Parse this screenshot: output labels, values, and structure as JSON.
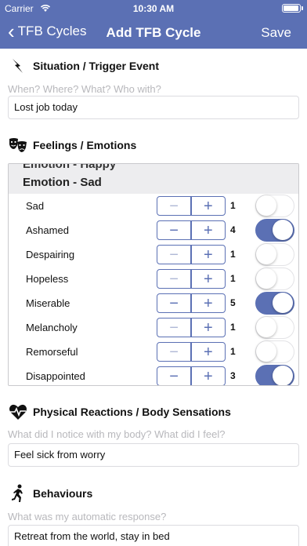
{
  "status": {
    "carrier": "Carrier",
    "time": "10:30 AM"
  },
  "nav": {
    "back_label": "TFB Cycles",
    "title": "Add TFB Cycle",
    "save_label": "Save"
  },
  "situation": {
    "heading": "Situation / Trigger Event",
    "icon": "lightning-icon",
    "placeholder": "When? Where? What? Who with?",
    "value": "Lost job today"
  },
  "feelings": {
    "heading": "Feelings / Emotions",
    "icon": "theater-masks-icon",
    "prev_group": "Emotion - Happy",
    "group": "Emotion - Sad",
    "items": [
      {
        "label": "Sad",
        "count": "1",
        "on": false
      },
      {
        "label": "Ashamed",
        "count": "4",
        "on": true
      },
      {
        "label": "Despairing",
        "count": "1",
        "on": false
      },
      {
        "label": "Hopeless",
        "count": "1",
        "on": false
      },
      {
        "label": "Miserable",
        "count": "5",
        "on": true
      },
      {
        "label": "Melancholy",
        "count": "1",
        "on": false
      },
      {
        "label": "Remorseful",
        "count": "1",
        "on": false
      },
      {
        "label": "Disappointed",
        "count": "3",
        "on": true
      }
    ]
  },
  "physical": {
    "heading": "Physical Reactions / Body Sensations",
    "icon": "heartbeat-icon",
    "placeholder": "What did I notice with my body? What did I feel?",
    "value": "Feel sick from worry"
  },
  "behaviours": {
    "heading": "Behaviours",
    "icon": "running-person-icon",
    "placeholder": "What was my automatic response?",
    "value": "Retreat from the world, stay in bed"
  },
  "colors": {
    "accent": "#5b70b4",
    "toggle_off_border": "#e3e3e6",
    "hint": "#b8b8bc"
  }
}
